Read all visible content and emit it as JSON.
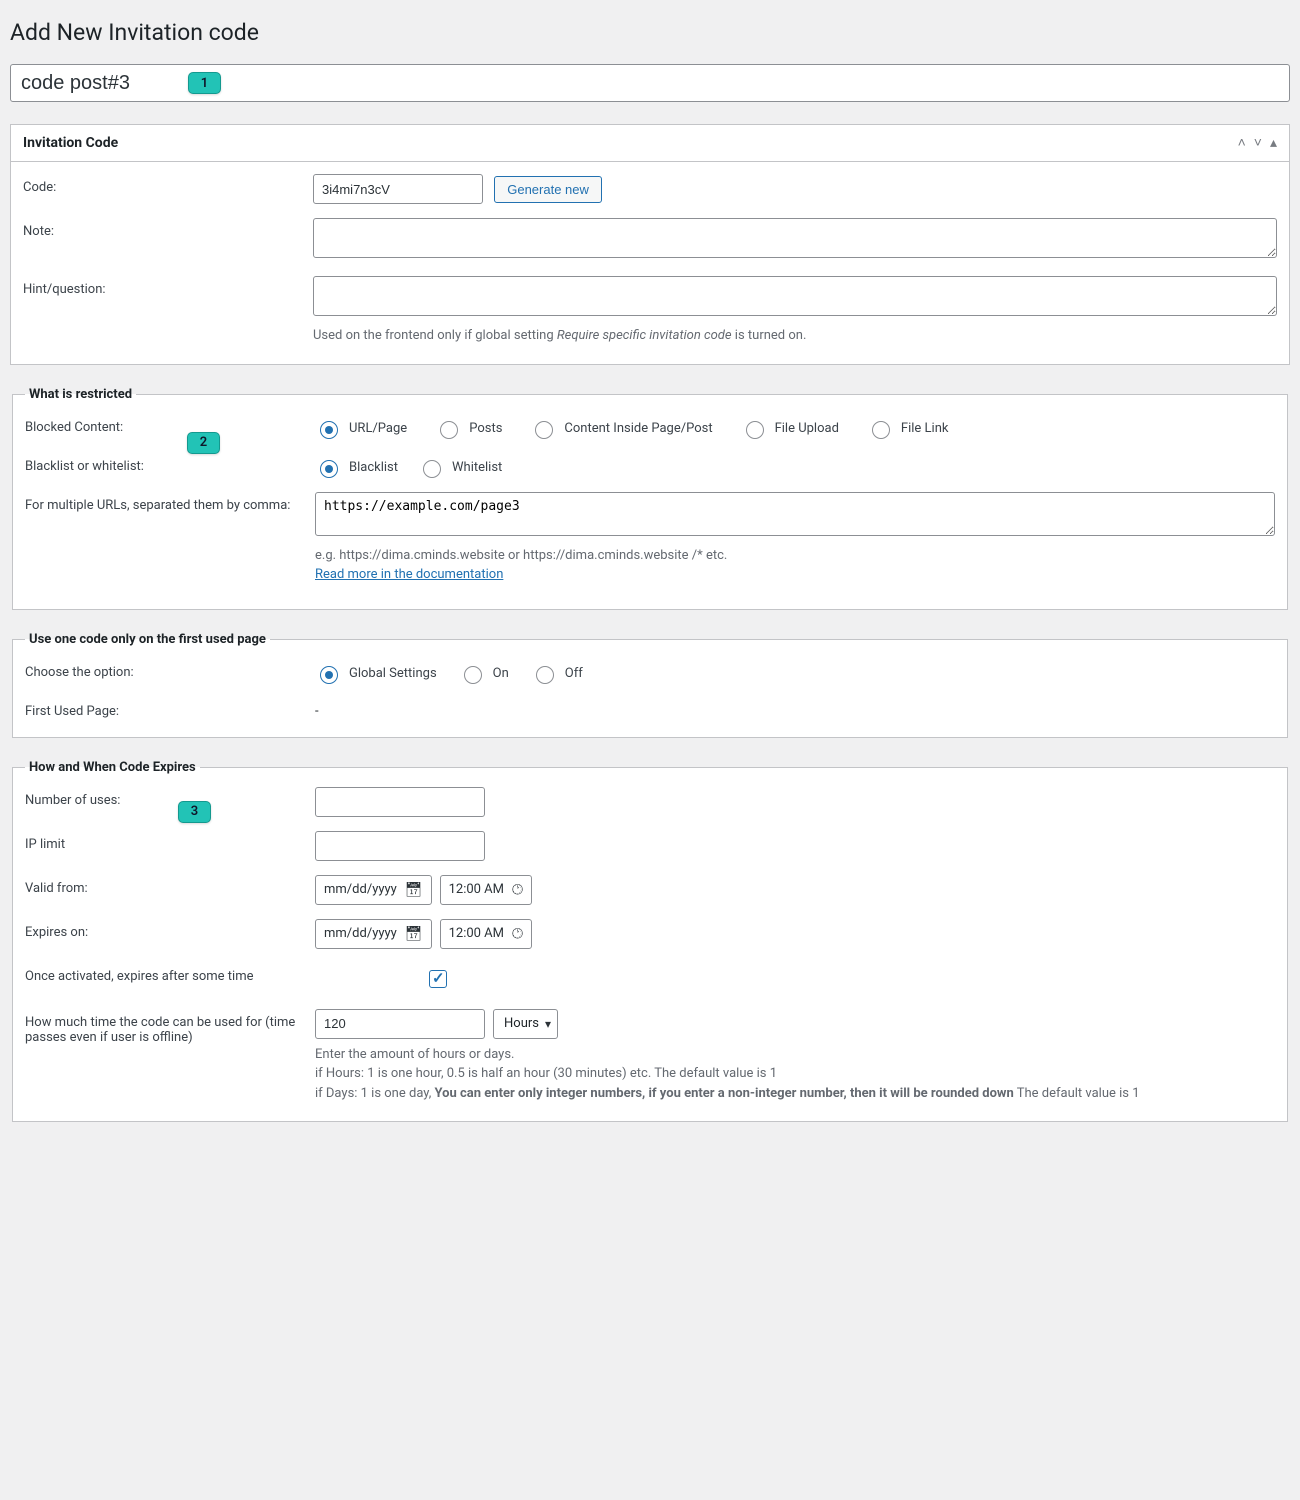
{
  "page": {
    "title": "Add New Invitation code"
  },
  "badges": {
    "b1": "1",
    "b2": "2",
    "b3": "3"
  },
  "titleInput": {
    "value": "code post#3"
  },
  "metabox": {
    "title": "Invitation Code",
    "code_label": "Code:",
    "code_value": "3i4mi7n3cV",
    "generate_btn": "Generate new",
    "note_label": "Note:",
    "hint_label": "Hint/question:",
    "hint_help_pre": "Used on the frontend only if global setting ",
    "hint_help_em": "Require specific invitation code",
    "hint_help_post": " is turned on."
  },
  "restricted": {
    "legend": "What is restricted",
    "blocked_label": "Blocked Content:",
    "blocked_options": [
      "URL/Page",
      "Posts",
      "Content Inside Page/Post",
      "File Upload",
      "File Link"
    ],
    "blocked_selected": 0,
    "bw_label": "Blacklist or whitelist:",
    "bw_options": [
      "Blacklist",
      "Whitelist"
    ],
    "bw_selected": 0,
    "urls_label": "For multiple URLs, separated them by comma:",
    "urls_value": "https://example.com/page3",
    "urls_help": "e.g. https://dima.cminds.website or https://dima.cminds.website /* etc.",
    "urls_link": "Read more in the documentation"
  },
  "firstUsed": {
    "legend": "Use one code only on the first used page",
    "choose_label": "Choose the option:",
    "choose_options": [
      "Global Settings",
      "On",
      "Off"
    ],
    "choose_selected": 0,
    "first_page_label": "First Used Page:",
    "first_page_value": "-"
  },
  "expiry": {
    "legend": "How and When Code Expires",
    "uses_label": "Number of uses:",
    "ip_label": "IP limit",
    "valid_from_label": "Valid from:",
    "expires_on_label": "Expires on:",
    "date_placeholder": "mm/dd/yyyy",
    "time_placeholder": "12:00 AM",
    "once_activated_label": "Once activated, expires after some time",
    "once_activated_checked": true,
    "duration_label": "How much time the code can be used for (time passes even if user is offline)",
    "duration_value": "120",
    "duration_unit": "Hours",
    "duration_help1": "Enter the amount of hours or days.",
    "duration_help2": "if Hours: 1 is one hour, 0.5 is half an hour (30 minutes) etc. The default value is 1",
    "duration_help3_pre": "if Days: 1 is one day, ",
    "duration_help3_b": "You can enter only integer numbers, if you enter a non-integer number, then it will be rounded down",
    "duration_help3_post": " The default value is 1"
  }
}
